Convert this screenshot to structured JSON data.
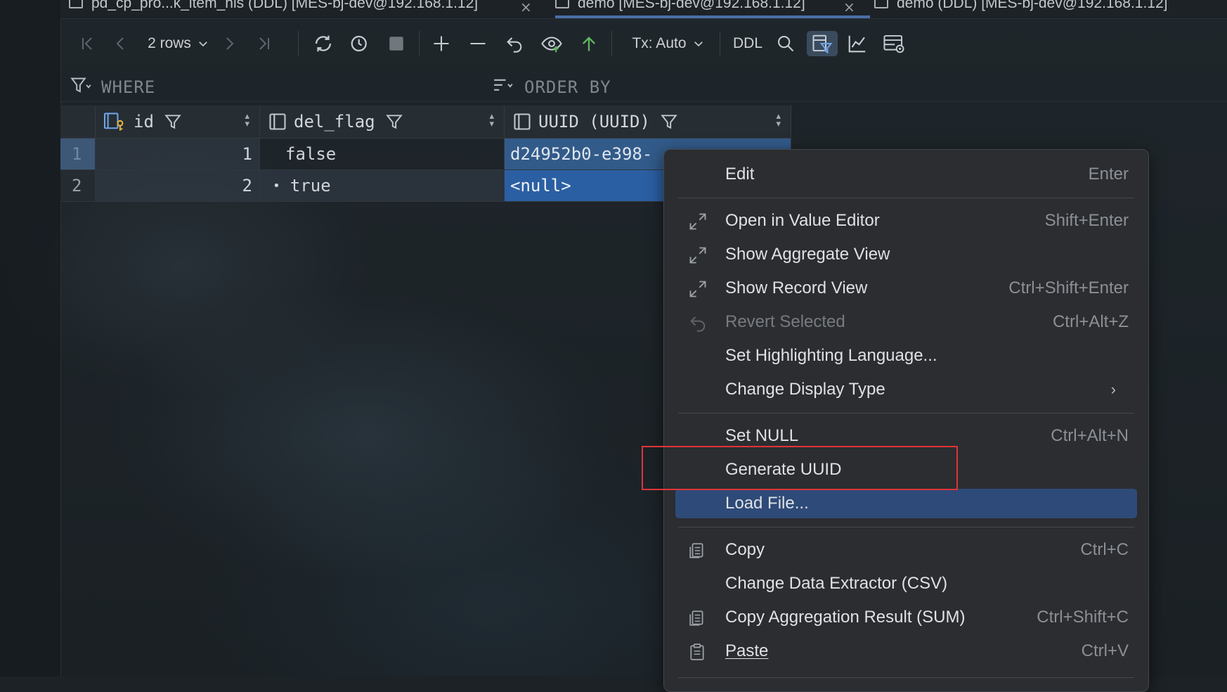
{
  "tabs": [
    {
      "label": "pd_cp_pro...k_item_his (DDL) [MES-bj-dev@192.168.1.12]"
    },
    {
      "label": "demo [MES-bj-dev@192.168.1.12]",
      "active": true
    },
    {
      "label": "demo (DDL) [MES-bj-dev@192.168.1.12]"
    }
  ],
  "toolbar": {
    "rows_label": "2 rows",
    "tx_label": "Tx: Auto",
    "ddl_label": "DDL"
  },
  "filter": {
    "where": "WHERE",
    "order_by": "ORDER BY"
  },
  "grid": {
    "columns": [
      {
        "name": "id"
      },
      {
        "name": "del_flag"
      },
      {
        "name": "UUID (UUID)"
      }
    ],
    "rows": [
      {
        "num": "1",
        "id": "1",
        "del_flag": "false",
        "uuid": "d24952b0-e398-"
      },
      {
        "num": "2",
        "id": "2",
        "del_flag": "true",
        "uuid": "<null>",
        "flag_dot": "•"
      }
    ]
  },
  "context_menu": {
    "items": [
      {
        "label": "Edit",
        "shortcut": "Enter"
      },
      {
        "label": "Open in Value Editor",
        "shortcut": "Shift+Enter"
      },
      {
        "label": "Show Aggregate View",
        "shortcut": ""
      },
      {
        "label": "Show Record View",
        "shortcut": "Ctrl+Shift+Enter"
      },
      {
        "label": "Revert Selected",
        "shortcut": "Ctrl+Alt+Z"
      },
      {
        "label": "Set Highlighting Language...",
        "shortcut": ""
      },
      {
        "label": "Change Display Type",
        "shortcut": ""
      },
      {
        "label": "Set NULL",
        "shortcut": "Ctrl+Alt+N"
      },
      {
        "label": "Generate UUID",
        "shortcut": ""
      },
      {
        "label": "Load File...",
        "shortcut": ""
      },
      {
        "label": "Copy",
        "shortcut": "Ctrl+C"
      },
      {
        "label": "Change Data Extractor (CSV)",
        "shortcut": ""
      },
      {
        "label": "Copy Aggregation Result (SUM)",
        "shortcut": "Ctrl+Shift+C"
      },
      {
        "label": "Paste",
        "shortcut": "Ctrl+V"
      }
    ]
  },
  "colors": {
    "menu_highlight": "#2e4a78",
    "annotation_box": "#e0343a",
    "selection": "#2b5fa3"
  }
}
